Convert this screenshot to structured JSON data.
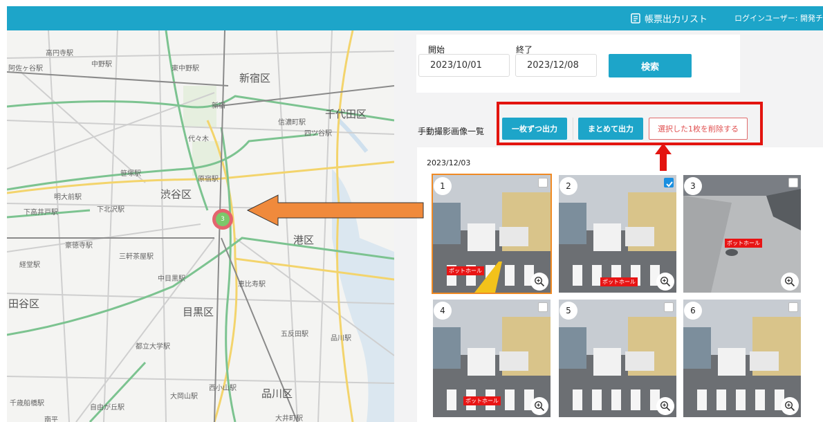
{
  "header": {
    "report_label": "帳票出力リスト",
    "user_label": "ログインユーザー: 開発チ",
    "color": "#1da5c9"
  },
  "map": {
    "labels": [
      "高円寺駅",
      "中野駅",
      "阿佐ヶ谷駅",
      "東中野駅",
      "新宿区",
      "新宿",
      "千代田区",
      "渋谷区",
      "原宿駅",
      "代々木",
      "笹塚駅",
      "明大前駅",
      "下北沢駅",
      "下高井戸駅",
      "豪徳寺駅",
      "三軒茶屋駅",
      "経堂駅",
      "中目黒駅",
      "恵比寿駅",
      "港区",
      "目黒区",
      "田谷区",
      "五反田駅",
      "品川駅",
      "都立大学駅",
      "西小山駅",
      "大岡山駅",
      "品川区",
      "自由が丘駅",
      "大井町駅",
      "千歳船橋駅",
      "南平",
      "信濃町駅",
      "四ツ谷駅"
    ],
    "cluster_count": "3"
  },
  "search": {
    "start_label": "開始",
    "start_value": "2023/10/01",
    "end_label": "終了",
    "end_value": "2023/12/08",
    "button_label": "検索"
  },
  "list": {
    "title": "手動撮影画像一覧",
    "btn_each": "一枚ずつ出力",
    "btn_bulk": "まとめて出力",
    "btn_delete": "選択した1枚を削除する"
  },
  "gallery": {
    "date": "2023/12/03",
    "tag_text": "ポットホール",
    "items": [
      {
        "num": "1",
        "checked": false,
        "selected": true
      },
      {
        "num": "2",
        "checked": true,
        "selected": false
      },
      {
        "num": "3",
        "checked": false,
        "selected": false
      },
      {
        "num": "4",
        "checked": false,
        "selected": false
      },
      {
        "num": "5",
        "checked": false,
        "selected": false
      },
      {
        "num": "6",
        "checked": false,
        "selected": false
      }
    ]
  },
  "colors": {
    "accent": "#1da5c9",
    "highlight_frame": "#e3140f",
    "arrow": "#f08a3c",
    "delete": "#e05050"
  }
}
